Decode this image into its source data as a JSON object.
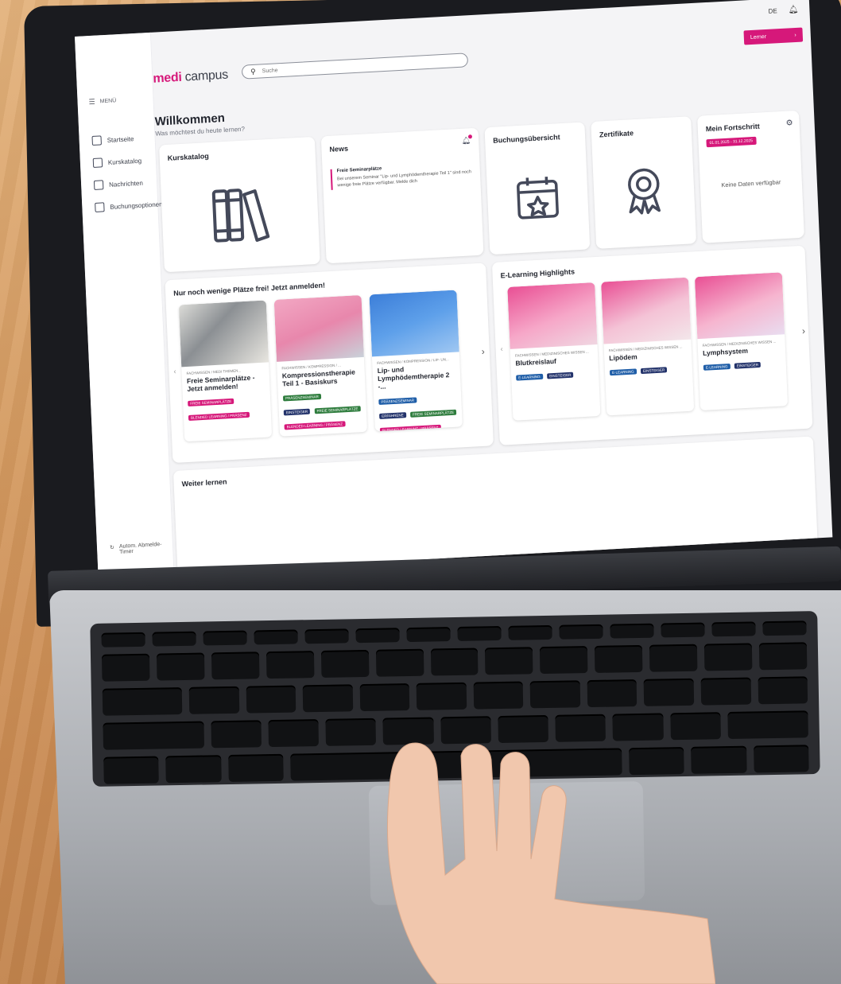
{
  "app": {
    "logo_strong": "medi",
    "logo_rest": " campus",
    "search_placeholder": "Suche",
    "language": "DE",
    "role_button": "Lerner",
    "role_chevron": "›"
  },
  "sidebar": {
    "menu_label": "MENÜ",
    "items": [
      {
        "label": "Startseite",
        "icon": "home-icon"
      },
      {
        "label": "Kurskatalog",
        "icon": "books-icon"
      },
      {
        "label": "Nachrichten",
        "icon": "messages-icon"
      },
      {
        "label": "Buchungsoptionen",
        "icon": "booking-icon"
      }
    ],
    "logout_timer": "Autom. Abmelde-Timer"
  },
  "welcome": {
    "title": "Willkommen",
    "subtitle": "Was möchtest du heute lernen?"
  },
  "tiles": {
    "kurskatalog": "Kurskatalog",
    "news": {
      "title": "News",
      "item_title": "Freie Seminarplätze",
      "item_text": "Bei unserem Seminar \"Lip- und Lymphödemtherapie Teil 1\" sind noch wenige freie Plätze verfügbar. Melde dich"
    },
    "buchungsuebersicht": "Buchungsübersicht",
    "zertifikate": "Zertifikate",
    "fortschritt": {
      "title": "Mein Fortschritt",
      "date_range": "01.01.2025 - 31.12.2025",
      "empty": "Keine Daten verfügbar"
    }
  },
  "seminars": {
    "title": "Nur noch wenige Plätze frei! Jetzt anmelden!",
    "courses": [
      {
        "category": "FACHWISSEN / MEDI THEMEN...",
        "title": "Freie Seminarplätze - Jetzt anmelden!",
        "tags": [
          {
            "text": "FREIE SEMINARPLÄTZE",
            "color": "#d6187a"
          },
          {
            "text": "BLENDED LEARNING / PRÄSENZ",
            "color": "#d6187a"
          }
        ]
      },
      {
        "category": "FACHWISSEN / KOMPRESSION / ...",
        "title": "Kompressionstherapie Teil 1 - Basiskurs",
        "tags": [
          {
            "text": "PRÄSENZSEMINAR",
            "color": "#2f7d3e"
          },
          {
            "text": "EINSTEIGER",
            "color": "#23336b"
          },
          {
            "text": "FREIE SEMINARPLÄTZE",
            "color": "#2f7d3e"
          },
          {
            "text": "BLENDED LEARNING / PRÄSENZ",
            "color": "#d6187a"
          }
        ]
      },
      {
        "category": "FACHWISSEN / KOMPRESSION / LIP- UN...",
        "title": "Lip- und Lymphödemtherapie 2 -...",
        "tags": [
          {
            "text": "PRÄSENZSEMINAR",
            "color": "#1f5ea8"
          },
          {
            "text": "ERFAHRENE",
            "color": "#23336b"
          },
          {
            "text": "FREIE SEMINARPLÄTZE",
            "color": "#2f7d3e"
          },
          {
            "text": "BLENDED LEARNING / PRÄSENZ",
            "color": "#d6187a"
          }
        ]
      }
    ]
  },
  "elearning": {
    "title": "E-Learning Highlights",
    "courses": [
      {
        "category": "FACHWISSEN / MEDIZINISCHES WISSEN ...",
        "title": "Blutkreislauf",
        "tags": [
          {
            "text": "E-LEARNING",
            "color": "#1f5ea8"
          },
          {
            "text": "EINSTEIGER",
            "color": "#23336b"
          }
        ]
      },
      {
        "category": "FACHWISSEN / MEDIZINISCHES WISSEN ...",
        "title": "Lipödem",
        "tags": [
          {
            "text": "E-LEARNING",
            "color": "#1f5ea8"
          },
          {
            "text": "EINSTEIGER",
            "color": "#23336b"
          }
        ]
      },
      {
        "category": "FACHWISSEN / MEDIZINISCHES WISSEN ...",
        "title": "Lymphsystem",
        "tags": [
          {
            "text": "E-LEARNING",
            "color": "#1f5ea8"
          },
          {
            "text": "EINSTEIGER",
            "color": "#23336b"
          }
        ]
      }
    ]
  },
  "continue": {
    "title": "Weiter lernen"
  },
  "colors": {
    "accent": "#d6187a",
    "text": "#23262f",
    "icon": "#44495a"
  }
}
